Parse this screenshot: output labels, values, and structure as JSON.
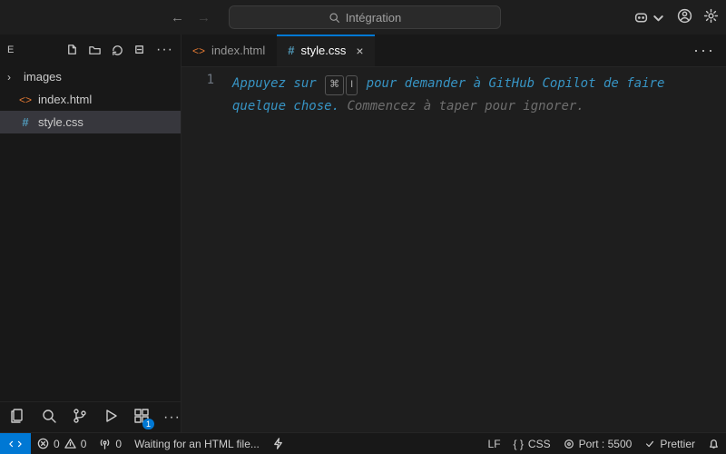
{
  "search": {
    "placeholder": "Intégration"
  },
  "sidebar": {
    "label": "E",
    "tree": [
      {
        "name": "images",
        "type": "folder"
      },
      {
        "name": "index.html",
        "type": "html"
      },
      {
        "name": "style.css",
        "type": "css",
        "active": true
      }
    ],
    "extensionsBadge": "1"
  },
  "tabs": [
    {
      "label": "index.html",
      "icon": "html",
      "active": false
    },
    {
      "label": "style.css",
      "icon": "css",
      "active": true
    }
  ],
  "editor": {
    "lineNumber": "1",
    "hint_blue_1": "Appuyez sur ",
    "hint_kbd_1": "⌘",
    "hint_kbd_2": "I",
    "hint_blue_2": " pour demander à GitHub Copilot de faire quelque chose. ",
    "hint_gray": "Commencez à taper pour ignorer."
  },
  "status": {
    "errors": "0",
    "warnings": "0",
    "ports": "0",
    "task": "Waiting for an HTML file...",
    "eol": "LF",
    "language": "CSS",
    "portLabel": "Port : 5500",
    "formatter": "Prettier"
  }
}
